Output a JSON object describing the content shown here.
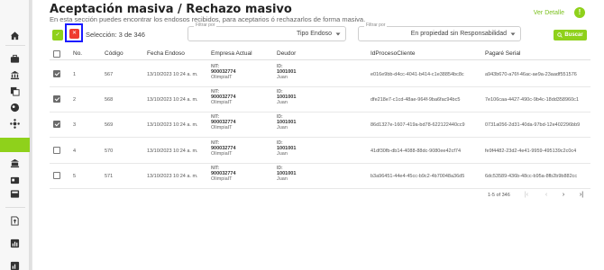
{
  "header": {
    "title": "Aceptación masiva / Rechazo masivo",
    "subtitle": "En esta sección puedes encontrar los endosos recibidos, para aceptarios ó rechazarlos de forma masiva.",
    "ver_detalle": "Ver Detalle",
    "info_icon": "!"
  },
  "toolbar": {
    "accept_icon": "✓",
    "reject_icon": "✕",
    "seleccion": "Selección: 3 de 346",
    "filter1": {
      "legend": "Filtrar por",
      "value": "Tipo Endoso"
    },
    "filter2": {
      "legend": "Filtrar por",
      "value": "En propiedad sin Responsabilidad"
    },
    "buscar_label": "Buscar"
  },
  "table": {
    "headers": {
      "no": "No.",
      "codigo": "Código",
      "fecha": "Fecha Endoso",
      "empresa": "Empresa Actual",
      "deudor": "Deudor",
      "idproceso": "IdProcesoCliente",
      "pagare": "Pagaré Serial"
    },
    "nit_label": "NIT:",
    "id_label": "ID:",
    "rows": [
      {
        "checked": true,
        "no": "1",
        "codigo": "567",
        "fecha": "13/10/2023 10:24 a. m.",
        "nit": "900032774",
        "empresa": "OlimpiaIT",
        "id": "1001001",
        "deudor": "Juan",
        "idproceso": "e016e9bb-d4cc-4041-b414-c1e38854bc8c",
        "pagare": "a943b670-a76f-46ac-ae9a-23aadf551576"
      },
      {
        "checked": true,
        "no": "2",
        "codigo": "568",
        "fecha": "13/10/2023 10:24 a. m.",
        "nit": "900032774",
        "empresa": "OlimpiaIT",
        "id": "1001001",
        "deudor": "Juan",
        "idproceso": "dfe218e7-c1cd-48ae-964f-9ba6fac94bc5",
        "pagare": "7e106caa-4427-490c-9b4c-18dd358960c1"
      },
      {
        "checked": true,
        "no": "3",
        "codigo": "569",
        "fecha": "13/10/2023 10:24 a. m.",
        "nit": "900032774",
        "empresa": "OlimpiaIT",
        "id": "1001001",
        "deudor": "Juan",
        "idproceso": "86d1327e-1607-419a-bd78-622122440cc9",
        "pagare": "0731a056-2d31-40da-97bd-12e402296bb9"
      },
      {
        "checked": false,
        "no": "4",
        "codigo": "570",
        "fecha": "13/10/2023 10:24 a. m.",
        "nit": "900032774",
        "empresa": "OlimpiaIT",
        "id": "1001001",
        "deudor": "Juan",
        "idproceso": "41df30fb-db14-4088-88dc-9080ee42cf74",
        "pagare": "fe9f4482-23d2-4e41-9959-495139c2c0c4"
      },
      {
        "checked": false,
        "no": "5",
        "codigo": "571",
        "fecha": "13/10/2023 10:24 a. m.",
        "nit": "900032774",
        "empresa": "OlimpiaIT",
        "id": "1001001",
        "deudor": "Juan",
        "idproceso": "b3a96451-44e4-45cc-b9c2-4b70048a36d5",
        "pagare": "6dc53589-436b-48cc-b95a-8fb2b9b882cc"
      }
    ]
  },
  "pagination": {
    "text": "1-5 of 346",
    "first": "|‹",
    "prev": "‹",
    "next": "›",
    "last": "›|"
  },
  "colors": {
    "accent": "#8fd11b",
    "reject": "#ef3b2f",
    "highlight": "#1a1aff"
  }
}
